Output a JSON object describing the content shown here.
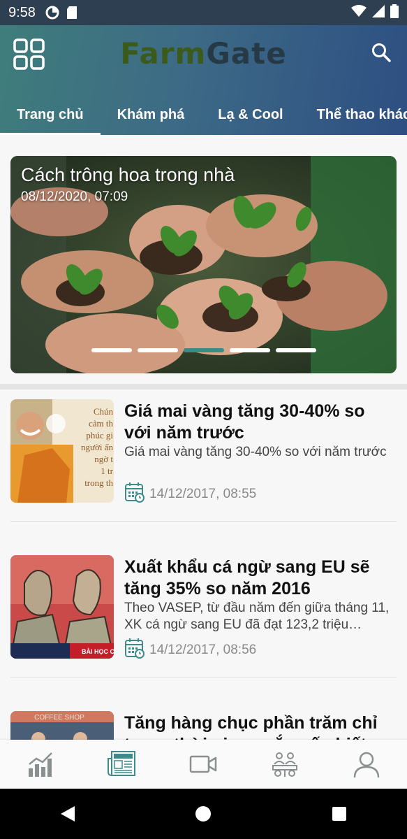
{
  "status_bar": {
    "time": "9:58"
  },
  "header": {
    "logo_part1": "Farm",
    "logo_part2": "Gate",
    "tabs": [
      {
        "label": "Trang chủ",
        "active": true
      },
      {
        "label": "Khám phá"
      },
      {
        "label": "Lạ & Cool"
      },
      {
        "label": "Thể thao khác"
      }
    ]
  },
  "featured": {
    "title": "Cách trông hoa trong nhà",
    "date": "08/12/2020, 07:09",
    "slide_count": 5,
    "active_slide": 3
  },
  "articles": [
    {
      "title": "Giá mai vàng tăng 30-40% so với năm trước",
      "description": "Giá mai vàng tăng 30-40% so với năm trước",
      "date": "14/12/2017, 08:55"
    },
    {
      "title": "Xuất khẩu cá ngừ sang EU sẽ tăng 35% so năm 2016",
      "description": "Theo VASEP, từ đầu năm đến giữa tháng 11, XK cá ngừ sang EU đã đạt 123,2 triệu…",
      "date": "14/12/2017, 08:56"
    },
    {
      "title": "Tăng hàng chục phần trăm chỉ trong thời gian ngắn nếu biết",
      "description": "",
      "date": ""
    }
  ],
  "thumb_text": {
    "a1": [
      "Chún",
      "cảm th",
      "phúc gi",
      "người ấn",
      "ngờ t",
      "1 tr",
      "trong th"
    ],
    "a2": "BÀI HỌC C",
    "a3": "COFFEE SHOP"
  },
  "bottom_nav": [
    "chart-icon",
    "news-icon",
    "video-icon",
    "community-icon",
    "profile-icon"
  ],
  "colors": {
    "accent": "#3e8a8a",
    "header_start": "#3f7d7b",
    "header_end": "#2d4f82"
  }
}
